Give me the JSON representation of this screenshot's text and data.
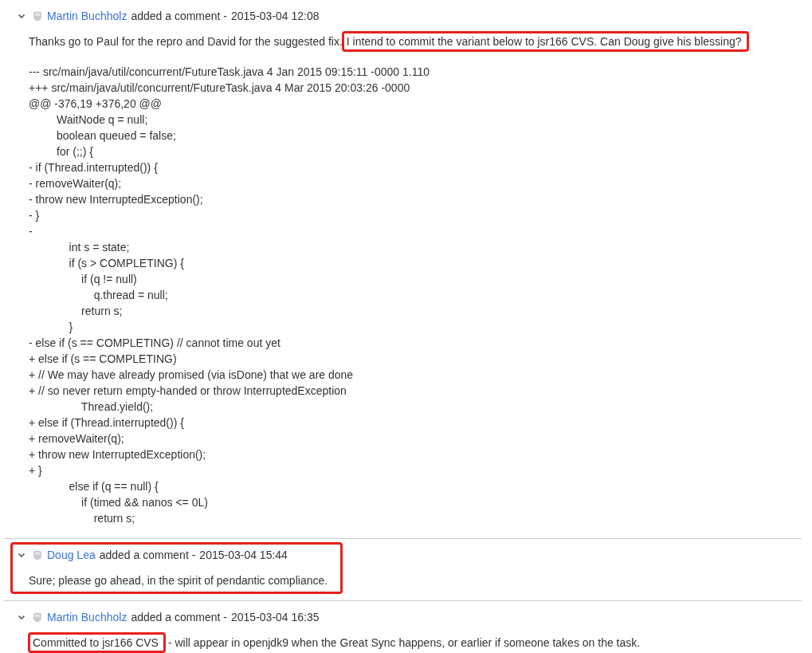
{
  "comments": [
    {
      "author": "Martin Buchholz",
      "action": "added a comment -",
      "timestamp": "2015-03-04 12:08",
      "expanded": true,
      "highlighted": false,
      "body": [
        {
          "kind": "paragraph",
          "segments": [
            {
              "text": "Thanks go to Paul for the repro and David for the suggested fix.",
              "highlighted": false
            },
            {
              "text": "I intend to commit the variant below to jsr166 CVS. Can Doug give his blessing?",
              "highlighted": true
            }
          ]
        },
        {
          "kind": "code",
          "lines": [
            "--- src/main/java/util/concurrent/FutureTask.java 4 Jan 2015 09:15:11 -0000 1.110",
            "+++ src/main/java/util/concurrent/FutureTask.java 4 Mar 2015 20:03:26 -0000",
            "@@ -376,19 +376,20 @@",
            "         WaitNode q = null;",
            "         boolean queued = false;",
            "         for (;;) {",
            "- if (Thread.interrupted()) {",
            "- removeWaiter(q);",
            "- throw new InterruptedException();",
            "- }",
            "-",
            "             int s = state;",
            "             if (s > COMPLETING) {",
            "                 if (q != null)",
            "                     q.thread = null;",
            "                 return s;",
            "             }",
            "- else if (s == COMPLETING) // cannot time out yet",
            "+ else if (s == COMPLETING)",
            "+ // We may have already promised (via isDone) that we are done",
            "+ // so never return empty-handed or throw InterruptedException",
            "                 Thread.yield();",
            "+ else if (Thread.interrupted()) {",
            "+ removeWaiter(q);",
            "+ throw new InterruptedException();",
            "+ }",
            "             else if (q == null) {",
            "                 if (timed && nanos <= 0L)",
            "                     return s;"
          ]
        }
      ]
    },
    {
      "author": "Doug Lea",
      "action": "added a comment -",
      "timestamp": "2015-03-04 15:44",
      "expanded": true,
      "highlighted": true,
      "body": [
        {
          "kind": "paragraph",
          "segments": [
            {
              "text": "Sure; please go ahead, in the spirit of pendantic compliance.",
              "highlighted": false
            }
          ]
        }
      ]
    },
    {
      "author": "Martin Buchholz",
      "action": "added a comment -",
      "timestamp": "2015-03-04 16:35",
      "expanded": true,
      "highlighted": false,
      "body": [
        {
          "kind": "paragraph",
          "segments": [
            {
              "text": "Committed to jsr166 CVS",
              "highlighted": true
            },
            {
              "text": "- will appear in openjdk9 when the Great Sync happens, or earlier if someone takes on the task.",
              "highlighted": false
            }
          ]
        }
      ]
    }
  ]
}
